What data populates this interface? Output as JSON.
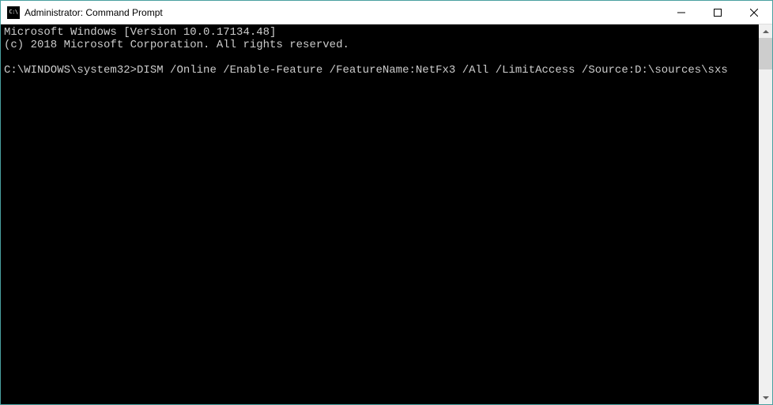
{
  "titlebar": {
    "icon_text": "C:\\",
    "title": "Administrator: Command Prompt"
  },
  "terminal": {
    "line1": "Microsoft Windows [Version 10.0.17134.48]",
    "line2": "(c) 2018 Microsoft Corporation. All rights reserved.",
    "blank": "",
    "prompt": "C:\\WINDOWS\\system32>",
    "command": "DISM /Online /Enable-Feature /FeatureName:NetFx3 /All /LimitAccess /Source:D:\\sources\\sxs"
  }
}
